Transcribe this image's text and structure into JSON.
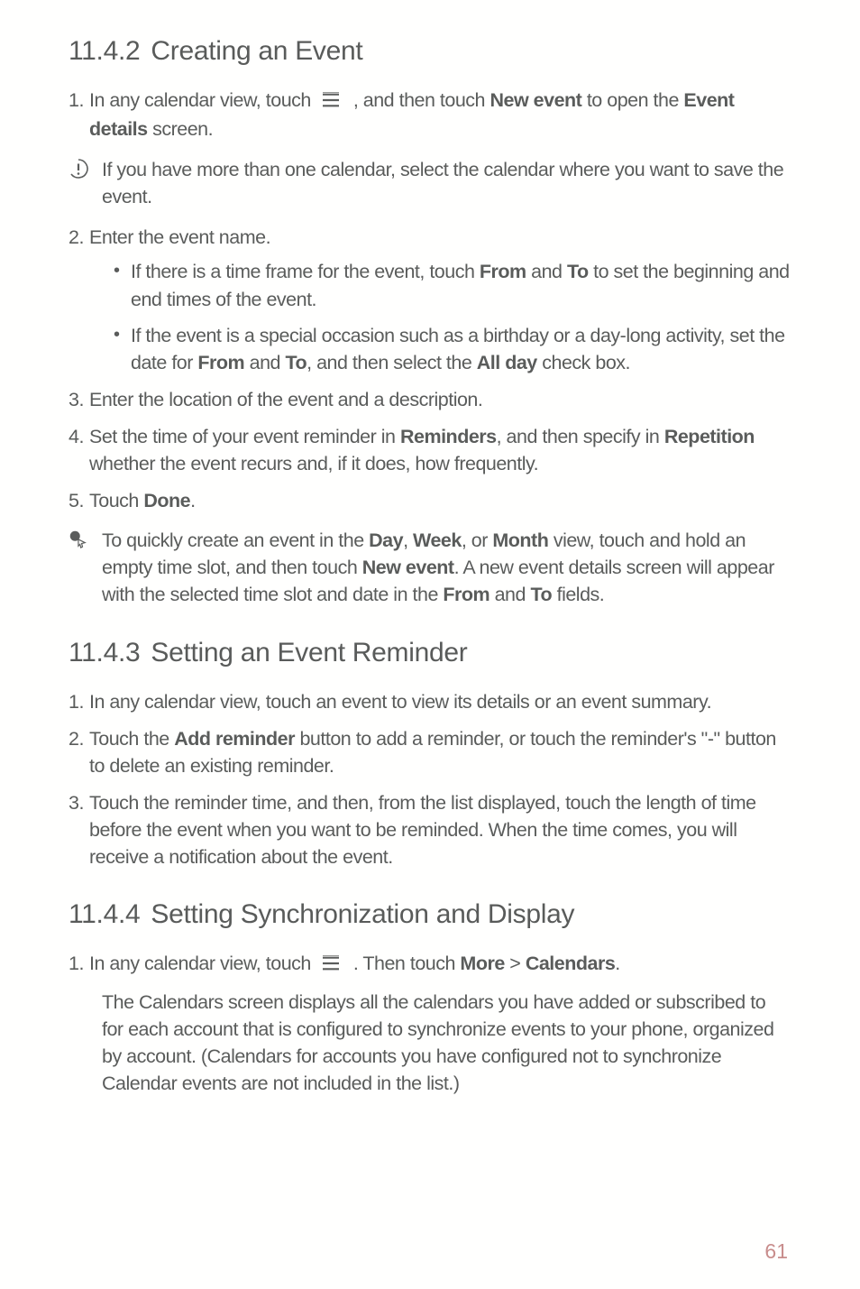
{
  "section1": {
    "num": "11.4.2",
    "title": "Creating an Event",
    "step1": {
      "n": "1.",
      "pre": "In any calendar view, touch ",
      "mid": " , and then touch ",
      "b1": "New event",
      "mid2": " to open the ",
      "b2": "Event details",
      "post": " screen."
    },
    "note": "If you have more than one calendar, select the calendar where you want to save the event.",
    "step2": {
      "n": "2.",
      "t": "Enter the event name."
    },
    "bullet1": {
      "pre": "If there is a time frame for the event, touch ",
      "b1": "From",
      "mid1": " and ",
      "b2": "To",
      "post": " to set the beginning and end times of the event."
    },
    "bullet2": {
      "pre": "If the event is a special occasion such as a birthday or a day-long activity, set the date for ",
      "b1": "From",
      "mid1": " and ",
      "b2": "To",
      "mid2": ", and then select the ",
      "b3": "All day",
      "post": " check box."
    },
    "step3": {
      "n": "3.",
      "t": "Enter the location of the event and a description."
    },
    "step4": {
      "n": "4.",
      "pre": "Set the time of your event reminder in ",
      "b1": "Reminders",
      "mid": ", and then specify in ",
      "b2": "Repetition",
      "post": " whether the event recurs and, if it does, how frequently."
    },
    "step5": {
      "n": "5.",
      "pre": "Touch ",
      "b1": "Done",
      "post": "."
    },
    "tip": {
      "pre": "To quickly create an event in the ",
      "b1": "Day",
      "c1": ", ",
      "b2": "Week",
      "c2": ", or ",
      "b3": "Month",
      "mid": " view, touch and hold an empty time slot, and then touch ",
      "b4": "New event",
      "mid2": ". A new event details screen will appear with the selected time slot and date in the ",
      "b5": "From",
      "c3": " and ",
      "b6": "To",
      "post": " fields."
    }
  },
  "section2": {
    "num": "11.4.3",
    "title": "Setting an Event Reminder",
    "step1": {
      "n": "1.",
      "t": "In any calendar view, touch an event to view its details or an event summary."
    },
    "step2": {
      "n": "2.",
      "pre": "Touch the ",
      "b1": "Add reminder",
      "post": " button to add a reminder, or touch the reminder's \"-\" button to delete an existing reminder."
    },
    "step3": {
      "n": "3.",
      "t": "Touch the reminder time, and then, from the list displayed, touch the length of time before the event when you want to be reminded. When the time comes, you will receive a notification about the event."
    }
  },
  "section3": {
    "num": "11.4.4",
    "title": "Setting Synchronization and Display",
    "step1": {
      "n": "1.",
      "pre": "In any calendar view, touch ",
      "mid": " . Then touch ",
      "b1": "More",
      "gt": " > ",
      "b2": "Calendars",
      "post": "."
    },
    "desc": "The Calendars screen displays all the calendars you have added or subscribed to for each account that is configured to synchronize events to your phone, organized by account. (Calendars for accounts you have configured not to synchronize Calendar events are not included in the list.)"
  },
  "page": "61"
}
